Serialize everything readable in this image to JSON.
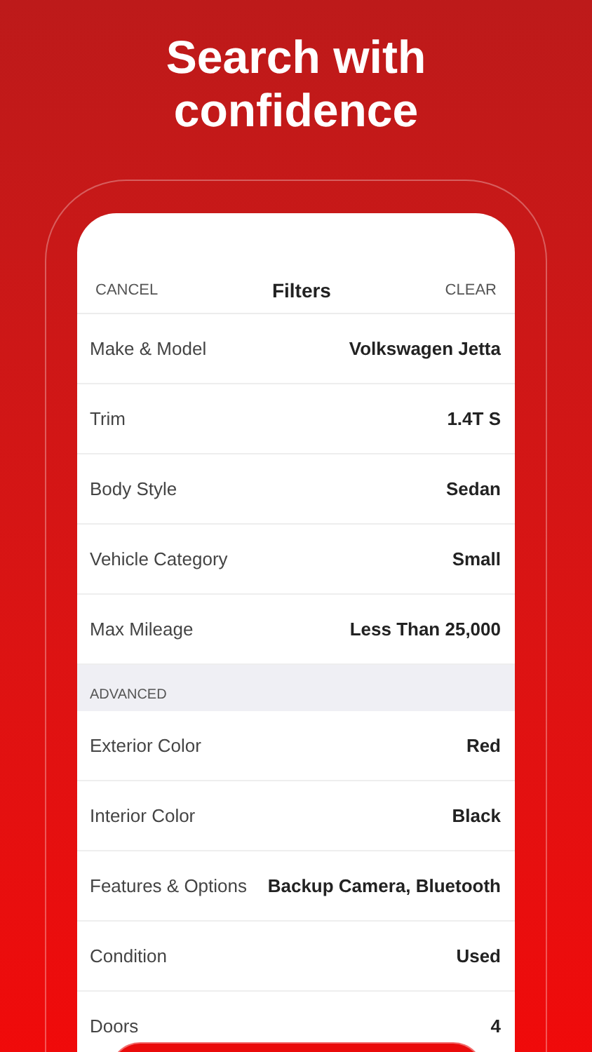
{
  "headline": "Search with confidence",
  "nav": {
    "cancel": "CANCEL",
    "title": "Filters",
    "clear": "CLEAR"
  },
  "filters": [
    {
      "label": "Make & Model",
      "value": "Volkswagen Jetta"
    },
    {
      "label": "Trim",
      "value": "1.4T S"
    },
    {
      "label": "Body Style",
      "value": "Sedan"
    },
    {
      "label": "Vehicle Category",
      "value": "Small"
    },
    {
      "label": "Max Mileage",
      "value": "Less Than 25,000"
    }
  ],
  "advanced": {
    "title": "ADVANCED",
    "rows": [
      {
        "label": "Exterior Color",
        "value": "Red"
      },
      {
        "label": "Interior Color",
        "value": "Black"
      },
      {
        "label": "Features & Options",
        "value": "Backup Camera, Bluetooth"
      },
      {
        "label": "Condition",
        "value": "Used"
      },
      {
        "label": "Doors",
        "value": "4"
      }
    ]
  }
}
